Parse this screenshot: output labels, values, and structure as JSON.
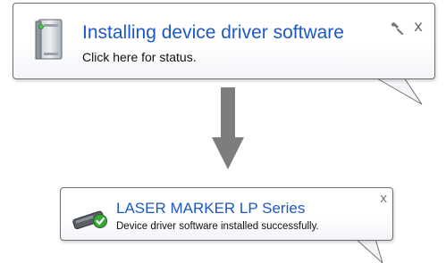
{
  "notification_installing": {
    "title": "Installing device driver software",
    "subtitle": "Click here for status.",
    "close_label": "x"
  },
  "notification_success": {
    "title": "LASER MARKER LP Series",
    "subtitle": "Device driver software installed successfully.",
    "close_label": "x"
  },
  "icons": {
    "device": "device-tower-icon",
    "wrench": "wrench-icon",
    "flow": "down-arrow-icon",
    "usb": "usb-device-icon",
    "check": "green-check-icon"
  },
  "colors": {
    "title_blue": "#1d58c4",
    "arrow_gray": "#7d7d7d",
    "check_green": "#3aa63a"
  }
}
